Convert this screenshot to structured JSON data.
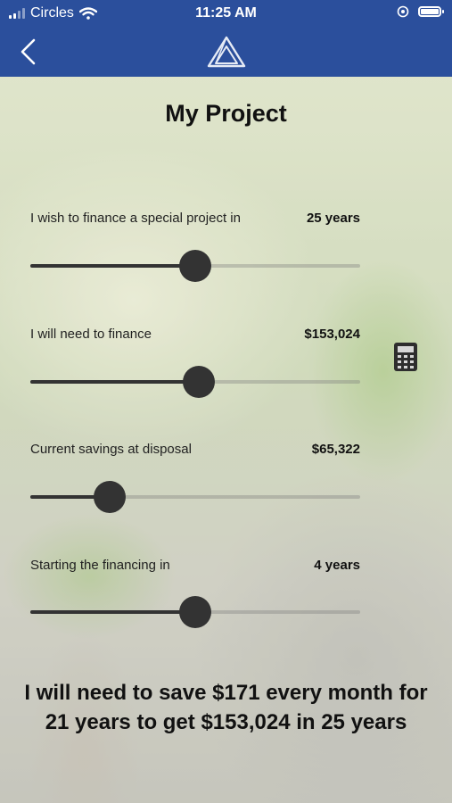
{
  "status_bar": {
    "carrier": "Circles",
    "time": "11:25 AM"
  },
  "page": {
    "title": "My Project"
  },
  "rows": [
    {
      "label": "I wish to finance a special project in",
      "value": "25 years",
      "slider_level": 0.5
    },
    {
      "label": "I will need to finance",
      "value": "$153,024",
      "slider_level": 0.51
    },
    {
      "label": "Current savings at disposal",
      "value": "$65,322",
      "slider_level": 0.24
    },
    {
      "label": "Starting the financing in",
      "value": "4 years",
      "slider_level": 0.5
    }
  ],
  "summary": {
    "line1": "I will need to save $171 every month for",
    "line2": "21 years to get $153,024 in 25 years"
  },
  "colors": {
    "nav_bar": "#2b4f9c",
    "slider": "#333333"
  },
  "icons": [
    "back-chevron-icon",
    "logo-triangle-icon",
    "calculator-icon",
    "wifi-icon",
    "battery-icon",
    "location-icon"
  ]
}
